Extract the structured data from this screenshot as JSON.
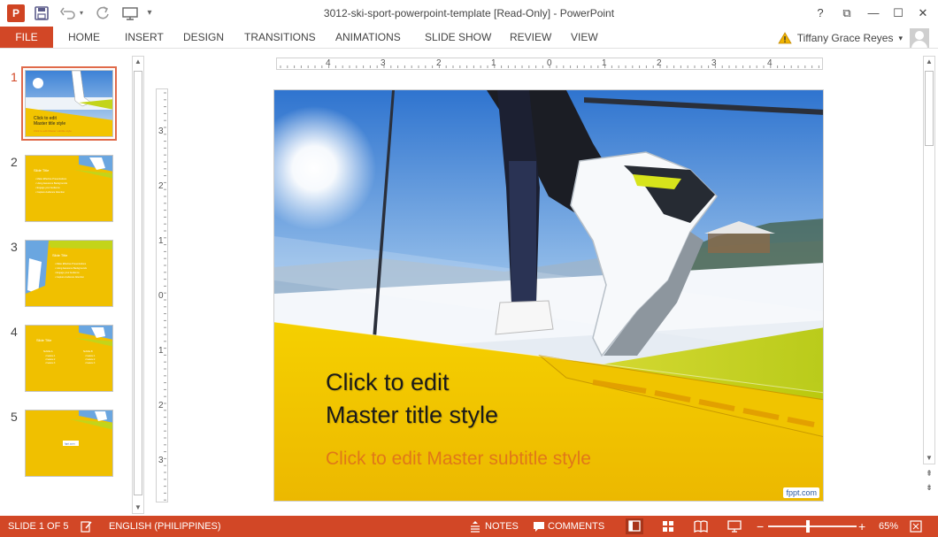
{
  "window": {
    "title": "3012-ski-sport-powerpoint-template [Read-Only] - PowerPoint",
    "help": "?",
    "controls": {
      "restore_ribbon": "⧉",
      "minimize": "—",
      "maximize": "☐",
      "close": "✕"
    }
  },
  "quick_access": {
    "app_icon_label": "P",
    "save_icon": "save-icon",
    "undo_icon": "undo-icon",
    "redo_icon": "redo-icon",
    "present_icon": "present-icon",
    "customize_icon": "customize-icon"
  },
  "ribbon": {
    "file": "FILE",
    "tabs": [
      "HOME",
      "INSERT",
      "DESIGN",
      "TRANSITIONS",
      "ANIMATIONS",
      "SLIDE SHOW",
      "REVIEW",
      "VIEW"
    ],
    "user": "Tiffany Grace Reyes",
    "dropdown": "▾"
  },
  "thumbnails": {
    "items": [
      {
        "number": "1",
        "title": "Click to edit\nMaster title style",
        "subtitle": "Click to edit Master subtitle style"
      },
      {
        "number": "2",
        "title": "Slide Title",
        "bullets": [
          "Make Effective Presentations",
          "Using Awesome Backgrounds",
          "Engage your Audience",
          "Capture Audience Attention"
        ]
      },
      {
        "number": "3",
        "title": "Slide Title",
        "bullets": [
          "Make Effective Presentations",
          "Using Awesome Backgrounds",
          "Engage your Audience",
          "Capture Audience Attention"
        ]
      },
      {
        "number": "4",
        "title": "Slide Title",
        "col_a": "Subtitle A",
        "col_b": "Subtitle B",
        "bullets": [
          "Feature 1",
          "Feature 2",
          "Feature 3"
        ]
      },
      {
        "number": "5",
        "label": "fppt.com"
      }
    ],
    "active": 0
  },
  "rulers": {
    "horizontal": [
      "4",
      "3",
      "2",
      "1",
      "0",
      "1",
      "2",
      "3",
      "4"
    ],
    "vertical": [
      "3",
      "2",
      "1",
      "0",
      "1",
      "2",
      "3"
    ]
  },
  "slide": {
    "title": "Click to edit\nMaster title style",
    "subtitle": "Click to edit Master subtitle style",
    "watermark": "fppt.com",
    "colors": {
      "title": "#1a1a1a",
      "subtitle": "#e07818",
      "band": "#f2c400",
      "sky": "#6aa6e0"
    }
  },
  "statusbar": {
    "slide_info": "SLIDE 1 OF 5",
    "language": "ENGLISH (PHILIPPINES)",
    "notes": "NOTES",
    "comments": "COMMENTS",
    "zoom": "65%",
    "zoom_minus": "−",
    "zoom_plus": "+",
    "zoom_level": 0.45
  }
}
